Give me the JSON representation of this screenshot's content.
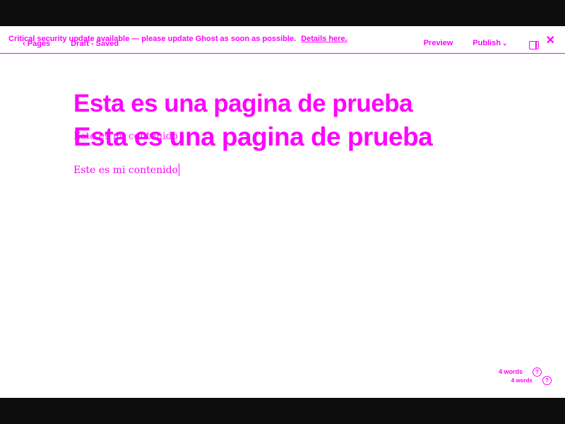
{
  "banner": {
    "text": "Critical security update available — please update Ghost as soon as possible.",
    "link": "Details here."
  },
  "nav": {
    "back_label": "Pages",
    "status": "Draft - Saved",
    "preview_label": "Preview",
    "publish_label": "Publish"
  },
  "editor": {
    "title_a": "Esta es una pagina de prueba",
    "title_b": "Esta es una pagina de prueba",
    "body_a": "Este es mi contenido",
    "body_b": "Este es mi contenido"
  },
  "footer": {
    "word_count_a": "4 words",
    "word_count_b": "4 words"
  },
  "colors": {
    "accent": "#ff00ff",
    "background": "#ffffff",
    "letterbox": "#0d0d0d"
  },
  "icons": [
    "chevron-left-icon",
    "chevron-down-icon",
    "sidebar-toggle-icon",
    "close-icon",
    "help-icon"
  ]
}
